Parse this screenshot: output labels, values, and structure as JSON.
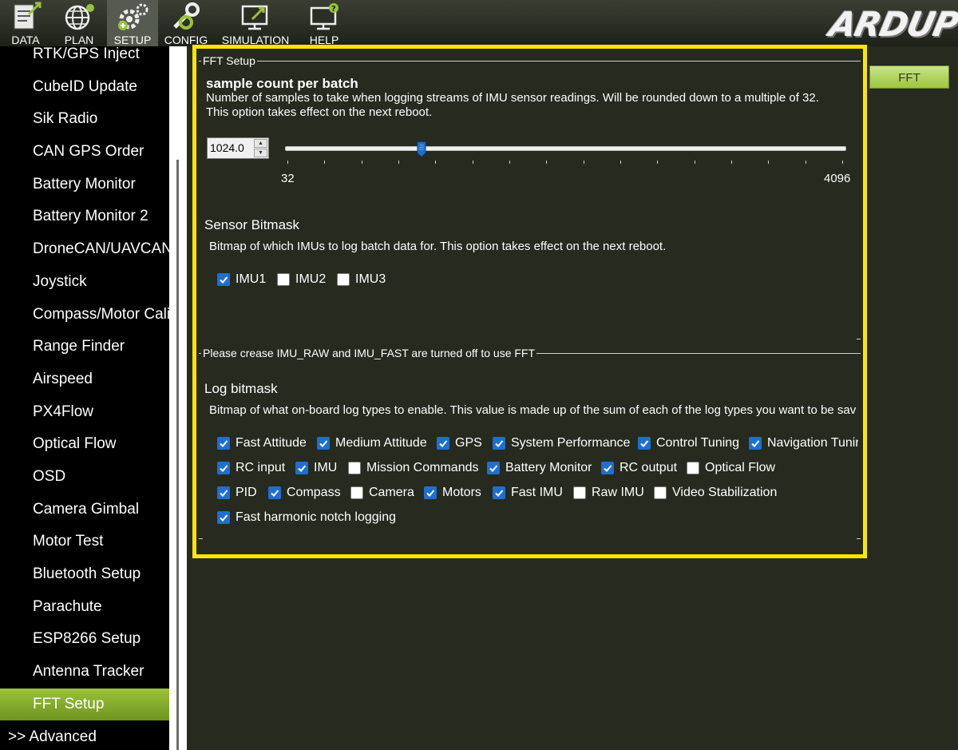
{
  "toolbar": {
    "items": [
      {
        "label": "DATA",
        "icon": "data-icon"
      },
      {
        "label": "PLAN",
        "icon": "plan-globe-icon"
      },
      {
        "label": "SETUP",
        "icon": "setup-gears-icon",
        "active": true
      },
      {
        "label": "CONFIG",
        "icon": "config-wrench-icon"
      },
      {
        "label": "SIMULATION",
        "icon": "simulation-monitor-icon"
      },
      {
        "label": "HELP",
        "icon": "help-monitor-icon"
      }
    ],
    "logo_text": "ARDUP"
  },
  "sidebar": {
    "items": [
      "RTK/GPS Inject",
      "CubeID Update",
      "Sik Radio",
      "CAN GPS Order",
      "Battery Monitor",
      "Battery Monitor 2",
      "DroneCAN/UAVCAN",
      "Joystick",
      "Compass/Motor Calib",
      "Range Finder",
      "Airspeed",
      "PX4Flow",
      "Optical Flow",
      "OSD",
      "Camera Gimbal",
      "Motor Test",
      "Bluetooth Setup",
      "Parachute",
      "ESP8266 Setup",
      "Antenna Tracker",
      "FFT Setup"
    ],
    "active": "FFT Setup",
    "advanced": ">> Advanced"
  },
  "fft_button": "FFT",
  "fft_setup": {
    "group_title": "FFT Setup",
    "sample_count": {
      "title": "sample count per batch",
      "desc_line1": "Number of samples to take when logging streams of IMU sensor readings.  Will be rounded down to a multiple of 32.",
      "desc_line2": "This option takes effect on the next reboot.",
      "value": "1024.0",
      "min_label": "32",
      "max_label": "4096",
      "min": 32,
      "max": 4096,
      "current": 1024
    },
    "sensor_bitmask": {
      "title": "Sensor Bitmask",
      "desc": "Bitmap of which IMUs to log batch data for. This option takes effect on the next reboot.",
      "options": [
        {
          "label": "IMU1",
          "checked": true
        },
        {
          "label": "IMU2",
          "checked": false
        },
        {
          "label": "IMU3",
          "checked": false
        }
      ]
    }
  },
  "log_group": {
    "group_title": "Please crease IMU_RAW and IMU_FAST are turned off to use FFT",
    "title": "Log bitmask",
    "desc": "Bitmap of what on-board log types to enable. This value is made up of the sum of each of the log types you want to be sav",
    "rows": [
      [
        {
          "label": "Fast Attitude",
          "checked": true
        },
        {
          "label": "Medium Attitude",
          "checked": true
        },
        {
          "label": "GPS",
          "checked": true
        },
        {
          "label": "System Performance",
          "checked": true
        },
        {
          "label": "Control Tuning",
          "checked": true
        },
        {
          "label": "Navigation Tunir",
          "checked": true
        }
      ],
      [
        {
          "label": "RC input",
          "checked": true
        },
        {
          "label": "IMU",
          "checked": true
        },
        {
          "label": "Mission Commands",
          "checked": false
        },
        {
          "label": "Battery Monitor",
          "checked": true
        },
        {
          "label": "RC output",
          "checked": true
        },
        {
          "label": "Optical Flow",
          "checked": false
        }
      ],
      [
        {
          "label": "PID",
          "checked": true
        },
        {
          "label": "Compass",
          "checked": true
        },
        {
          "label": "Camera",
          "checked": false
        },
        {
          "label": "Motors",
          "checked": true
        },
        {
          "label": "Fast IMU",
          "checked": true
        },
        {
          "label": "Raw IMU",
          "checked": false
        },
        {
          "label": "Video Stabilization",
          "checked": false
        }
      ],
      [
        {
          "label": "Fast harmonic notch logging",
          "checked": true
        }
      ]
    ]
  },
  "colors": {
    "background": "#262a1f",
    "accent_green": "#9bc23a",
    "highlight_yellow": "#ffe500",
    "checkbox_blue": "#1f6fd0"
  }
}
